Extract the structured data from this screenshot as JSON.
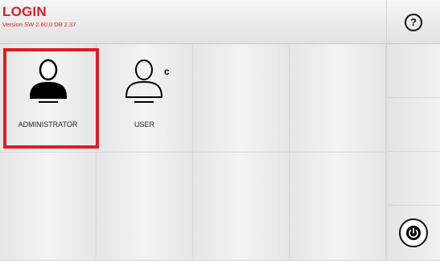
{
  "header": {
    "title": "LOGIN",
    "version": "Version SW 2.60.0 DB 2.37",
    "help_icon": "help-icon"
  },
  "users": [
    {
      "label": "ADMINISTRATOR",
      "icon": "admin-user-icon",
      "selected": true
    },
    {
      "label": "USER",
      "icon": "user-icon",
      "selected": false
    }
  ],
  "power_icon": "power-icon",
  "colors": {
    "accent": "#d4202a",
    "selection": "#e01b24"
  }
}
